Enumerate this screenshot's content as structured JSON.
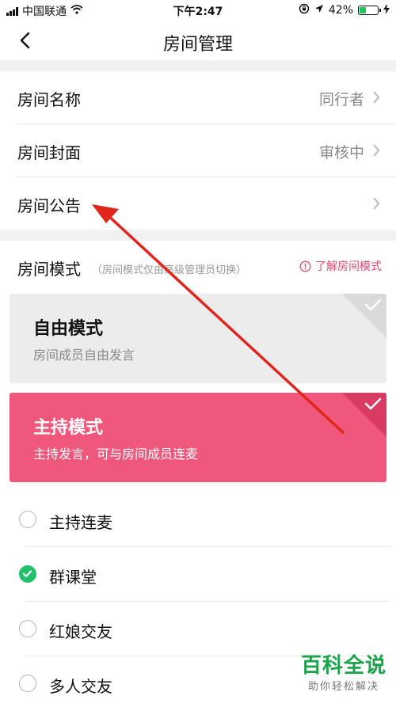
{
  "status_bar": {
    "carrier": "中国联通",
    "time": "下午2:47",
    "battery_text": "42%",
    "battery_level": 0.42,
    "icons": [
      "signal-icon",
      "wifi-icon",
      "rotation-lock-icon",
      "location-icon",
      "battery-icon",
      "charging-icon"
    ]
  },
  "header": {
    "title": "房间管理",
    "back_icon": "chevron-left-icon"
  },
  "settings": [
    {
      "label": "房间名称",
      "value": "同行者"
    },
    {
      "label": "房间封面",
      "value": "审核中"
    },
    {
      "label": "房间公告",
      "value": ""
    }
  ],
  "mode_section": {
    "label": "房间模式",
    "note": "（房间模式仅由高级管理员切换）",
    "learn_more": "了解房间模式"
  },
  "mode_cards": [
    {
      "title": "自由模式",
      "desc": "房间成员自由发言",
      "selected": false
    },
    {
      "title": "主持模式",
      "desc": "主持发言，可与房间成员连麦",
      "selected": true
    }
  ],
  "host_options": [
    {
      "label": "主持连麦",
      "checked": false
    },
    {
      "label": "群课堂",
      "checked": true
    },
    {
      "label": "红娘交友",
      "checked": false
    },
    {
      "label": "多人交友",
      "checked": false
    }
  ],
  "colors": {
    "accent_pink": "#f0587b",
    "check_green": "#23c16b",
    "annotation_red": "#e0261c",
    "watermark_green": "#1aa34a"
  },
  "watermark": {
    "title": "百科全说",
    "subtitle": "助你轻松解决"
  }
}
